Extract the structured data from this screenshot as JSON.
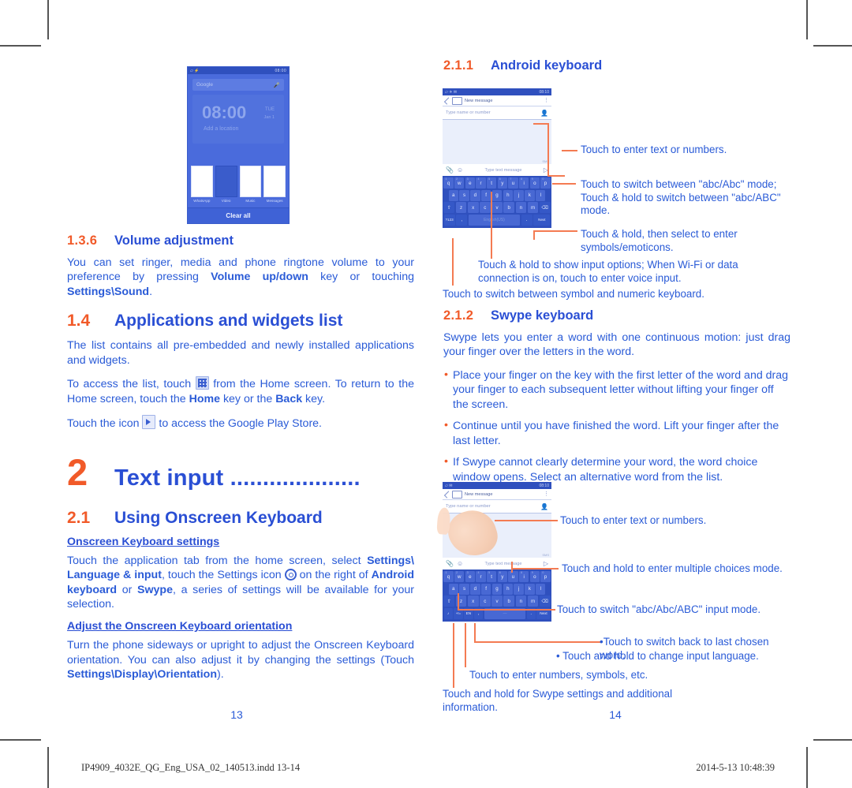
{
  "document": {
    "footer_file": "IP4909_4032E_QG_Eng_USA_02_140513.indd   13-14",
    "footer_timestamp": "2014-5-13   10:48:39",
    "page_left": "13",
    "page_right": "14"
  },
  "colors": {
    "heading_blue": "#2A4FD4",
    "body_blue": "#2A5BD7",
    "accent_orange": "#F15A29",
    "annotation_orange": "#F47B52",
    "phone_blue": "#3F62D6"
  },
  "left_column": {
    "section_136": {
      "number": "1.3.6",
      "title": "Volume adjustment",
      "paragraph_pre": "You can set ringer, media and phone ringtone volume to your preference by pressing ",
      "bold_1": "Volume up/down",
      "paragraph_mid": " key or touching ",
      "bold_2": "Settings\\",
      "bold_3": "Sound",
      "paragraph_end": "."
    },
    "section_14": {
      "number": "1.4",
      "title": "Applications and widgets list",
      "p1": "The list contains all pre-embedded and newly installed applications and widgets.",
      "p2_a": "To access the list, touch ",
      "p2_b": " from the Home screen. To return to the Home screen, touch the ",
      "p2_bold1": "Home",
      "p2_c": " key or the ",
      "p2_bold2": "Back",
      "p2_d": " key.",
      "p3_a": "Touch the icon ",
      "p3_b": " to access the Google Play Store."
    },
    "chapter_2": {
      "number": "2",
      "title": "Text input ...................."
    },
    "section_21": {
      "number": "2.1",
      "title": "Using Onscreen Keyboard",
      "sub1_heading": "Onscreen Keyboard settings",
      "sub1_a": "Touch the application tab from the home screen, select ",
      "sub1_bold1": "Settings\\",
      "sub1_bold2": "Language & input",
      "sub1_b": ", touch the Settings icon ",
      "sub1_c": " on the right of ",
      "sub1_bold3": "Android keyboard",
      "sub1_d": " or ",
      "sub1_bold4": "Swype",
      "sub1_e": ", a series of settings will be available for your selection.",
      "sub2_heading": "Adjust the Onscreen Keyboard orientation",
      "sub2_a": "Turn the phone sideways or upright to adjust the Onscreen Keyboard orientation. You can also adjust it by changing the settings (Touch ",
      "sub2_bold": "Settings\\Display\\Orientation",
      "sub2_b": ")."
    }
  },
  "right_column": {
    "section_211": {
      "number": "2.1.1",
      "title": "Android keyboard",
      "annotations": [
        "Touch to enter text or numbers.",
        "Touch to switch  between \"abc/Abc\" mode; Touch & hold to switch between \"abc/ABC\" mode.",
        "Touch & hold, then select to enter symbols/emoticons.",
        "Touch & hold to show input options; When Wi-Fi or data connection is on, touch to enter voice input.",
        "Touch to switch between symbol and numeric keyboard."
      ]
    },
    "section_212": {
      "number": "2.1.2",
      "title": "Swype keyboard",
      "intro": "Swype lets you enter a word with one continuous motion: just drag your finger over the letters in the word.",
      "bullets": [
        "Place your finger on the key with the first letter of the word and drag your finger to each subsequent letter without lifting your finger off the screen.",
        "Continue until you have finished the word. Lift your finger after the last letter.",
        "If Swype cannot clearly determine your word, the word choice window opens. Select an alternative word from the list."
      ],
      "annotations": [
        "Touch to enter text or numbers.",
        "Touch and hold to enter multiple choices mode.",
        "Touch to switch \"abc/Abc/ABC\" input mode.",
        "•Touch to switch back to last chosen word.",
        "• Touch and hold to change input language.",
        "Touch to enter numbers, symbols, etc.",
        "Touch and hold for Swype settings and additional information."
      ]
    }
  },
  "home_screen_mock": {
    "status_right": "08:00",
    "search_placeholder": "Google",
    "clock_time": "08:00",
    "clock_day": "TUE",
    "clock_date": "Jan 1",
    "clock_location": "Add a location",
    "recents": [
      {
        "caption": "WhatsApp"
      },
      {
        "caption": "Video"
      },
      {
        "caption": "Music"
      },
      {
        "caption": "Messages"
      }
    ],
    "clear_all": "Clear all"
  },
  "android_kb_mock": {
    "status_right": "08:10",
    "title": "New message",
    "recipient_placeholder": "Type name or number",
    "sms_label": "SMS",
    "compose_placeholder": "Type text message",
    "rows": [
      [
        {
          "label": "q",
          "sup": "1"
        },
        {
          "label": "w",
          "sup": "2"
        },
        {
          "label": "e",
          "sup": "3"
        },
        {
          "label": "r",
          "sup": "4"
        },
        {
          "label": "t",
          "sup": "5"
        },
        {
          "label": "y",
          "sup": "6"
        },
        {
          "label": "u",
          "sup": "7"
        },
        {
          "label": "i",
          "sup": "8"
        },
        {
          "label": "o",
          "sup": "9"
        },
        {
          "label": "p",
          "sup": "0"
        }
      ],
      [
        {
          "label": "a"
        },
        {
          "label": "s"
        },
        {
          "label": "d"
        },
        {
          "label": "f"
        },
        {
          "label": "g"
        },
        {
          "label": "h"
        },
        {
          "label": "j"
        },
        {
          "label": "k"
        },
        {
          "label": "l"
        }
      ],
      [
        {
          "label": "⇧"
        },
        {
          "label": "z"
        },
        {
          "label": "x"
        },
        {
          "label": "c"
        },
        {
          "label": "v"
        },
        {
          "label": "b"
        },
        {
          "label": "n"
        },
        {
          "label": "m"
        },
        {
          "label": "⌫"
        }
      ],
      [
        {
          "label": "?123"
        },
        {
          "label": ","
        },
        {
          "label": "English(US)"
        },
        {
          "label": "."
        },
        {
          "label": "Next"
        }
      ]
    ]
  },
  "swype_kb_mock": {
    "status_right": "08:10",
    "title": "New message",
    "recipient_placeholder": "Type name or number",
    "sms_label": "SMS",
    "compose_placeholder": "Type text message",
    "rows": [
      [
        {
          "label": "q",
          "sup": "1"
        },
        {
          "label": "w",
          "sup": "2"
        },
        {
          "label": "e",
          "sup": "3"
        },
        {
          "label": "r",
          "sup": "4"
        },
        {
          "label": "t",
          "sup": "5"
        },
        {
          "label": "y",
          "sup": "6"
        },
        {
          "label": "u",
          "sup": "7"
        },
        {
          "label": "i",
          "sup": "8"
        },
        {
          "label": "o",
          "sup": "9"
        },
        {
          "label": "p",
          "sup": "0"
        }
      ],
      [
        {
          "label": "a"
        },
        {
          "label": "s"
        },
        {
          "label": "d"
        },
        {
          "label": "f"
        },
        {
          "label": "g"
        },
        {
          "label": "h"
        },
        {
          "label": "j"
        },
        {
          "label": "k"
        },
        {
          "label": "l"
        }
      ],
      [
        {
          "label": "⇧"
        },
        {
          "label": "z"
        },
        {
          "label": "x"
        },
        {
          "label": "c"
        },
        {
          "label": "v"
        },
        {
          "label": "b"
        },
        {
          "label": "n"
        },
        {
          "label": "m"
        },
        {
          "label": "⌫"
        }
      ],
      [
        {
          "label": "♪"
        },
        {
          "label": "+!="
        },
        {
          "label": "EN"
        },
        {
          "label": ","
        },
        {
          "label": "—"
        },
        {
          "label": "."
        },
        {
          "label": "Next"
        }
      ]
    ]
  }
}
